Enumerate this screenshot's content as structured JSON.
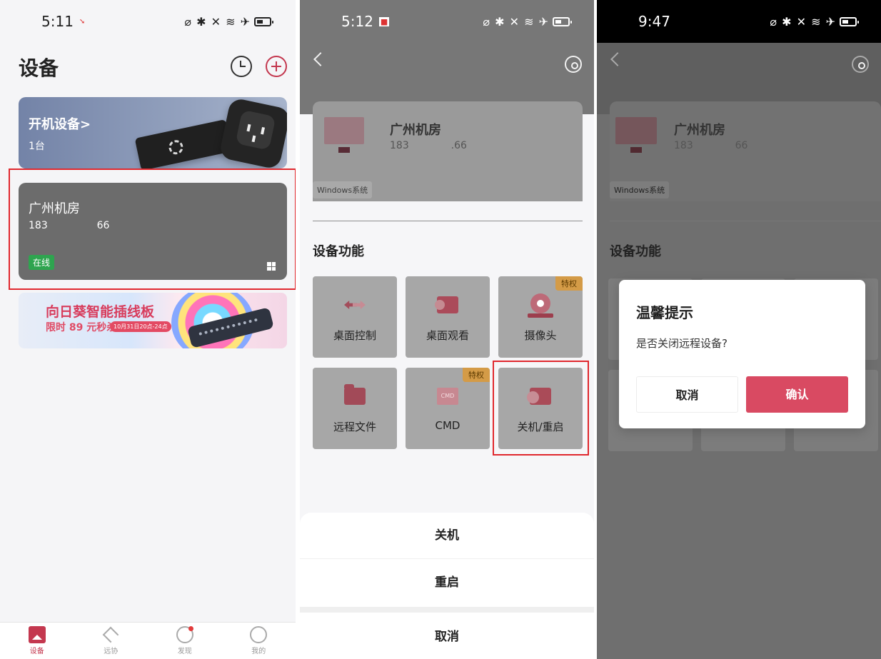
{
  "panel1": {
    "status_time": "5:11",
    "status_icons": "⌀ ✱ ✕ ≋ ✈",
    "title": "设备",
    "boot_device": {
      "title": "开机设备>",
      "count": "1台"
    },
    "device": {
      "name": "广州机房",
      "ip_prefix": "183",
      "ip_suffix": "66",
      "status": "在线"
    },
    "ad": {
      "title": "向日葵智能插线板",
      "price": "限时 89 元秒杀",
      "date": "10月31日20点-24点"
    },
    "bottom_nav": [
      "设备",
      "远协",
      "发现",
      "我的"
    ]
  },
  "panel2": {
    "status_time": "5:12",
    "status_icons": "⌀ ✱ ✕ ≋ ✈",
    "device": {
      "name": "广州机房",
      "ip_prefix": "183",
      "ip_suffix": ".66",
      "os": "Windows系统"
    },
    "section_title": "设备功能",
    "features": [
      {
        "label": "桌面控制",
        "badge": ""
      },
      {
        "label": "桌面观看",
        "badge": ""
      },
      {
        "label": "摄像头",
        "badge": "特权"
      },
      {
        "label": "远程文件",
        "badge": ""
      },
      {
        "label": "CMD",
        "badge": "特权",
        "icon_text": "CMD"
      },
      {
        "label": "关机/重启",
        "badge": ""
      }
    ],
    "sheet": [
      "关机",
      "重启",
      "取消"
    ]
  },
  "panel3": {
    "status_time": "9:47",
    "status_icons": "⌀ ✱ ✕ ≋ ✈",
    "device": {
      "name": "广州机房",
      "ip_prefix": "183",
      "ip_suffix": "66",
      "os": "Windows系统"
    },
    "section_title": "设备功能",
    "dialog": {
      "title": "温馨提示",
      "message": "是否关闭远程设备?",
      "cancel": "取消",
      "confirm": "确认"
    }
  },
  "colors": {
    "accent": "#d94a62",
    "online": "#2ea44f",
    "highlight": "#e0282e"
  }
}
